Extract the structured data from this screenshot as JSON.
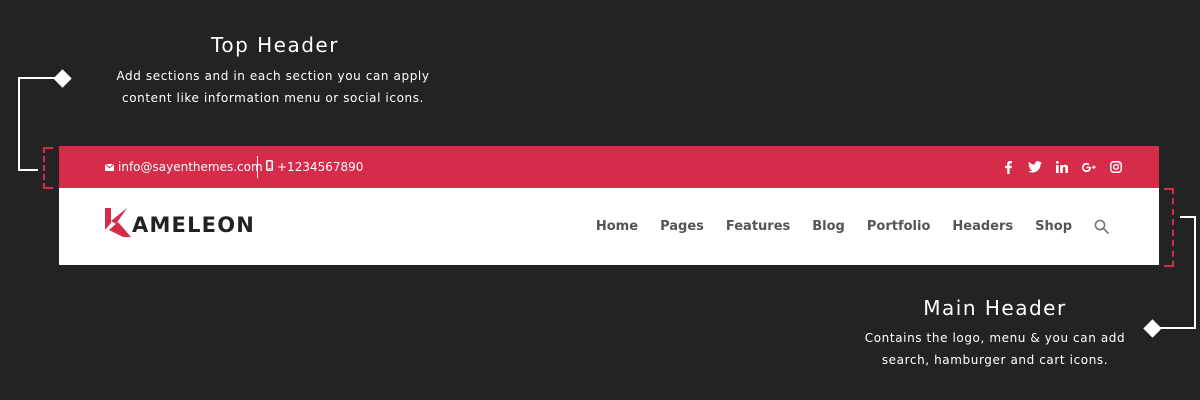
{
  "annotations": {
    "top": {
      "title": "Top Header",
      "description_line1": "Add sections and in each section  you can apply",
      "description_line2": "content like information menu or social icons."
    },
    "main": {
      "title": "Main Header",
      "description_line1": "Contains the logo, menu & you can add",
      "description_line2": "search, hamburger and cart icons."
    }
  },
  "top_bar": {
    "email": "info@sayenthemes.com",
    "email_icon": "envelope-icon",
    "phone": "+1234567890",
    "phone_icon": "mobile-phone-icon",
    "social_icons": [
      "facebook-icon",
      "twitter-icon",
      "linkedin-icon",
      "google-plus-icon",
      "instagram-icon"
    ]
  },
  "main_bar": {
    "logo_text": "AMELEON",
    "nav": [
      "Home",
      "Pages",
      "Features",
      "Blog",
      "Portfolio",
      "Headers",
      "Shop"
    ],
    "search_icon": "search-icon"
  },
  "colors": {
    "background": "#232323",
    "accent": "#d62c4a",
    "header_bg": "#ffffff",
    "nav_text": "#555555",
    "logo_text": "#222222"
  }
}
